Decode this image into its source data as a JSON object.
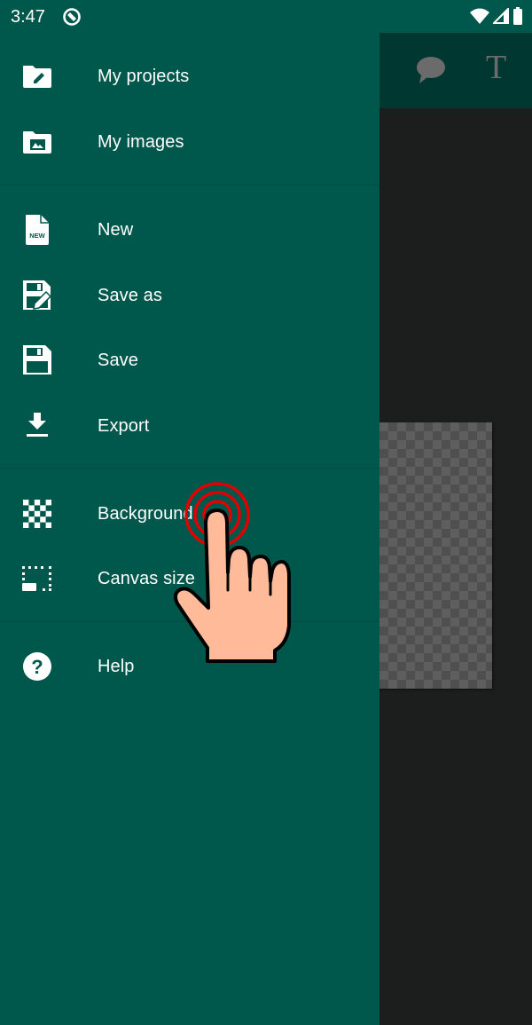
{
  "status_bar": {
    "time": "3:47",
    "icons": [
      "app-notification-icon",
      "wifi-icon",
      "cell-signal-icon",
      "battery-icon"
    ]
  },
  "app_toolbar": {
    "icons": [
      "comment-icon",
      "text-icon"
    ],
    "text_tool_glyph": "T"
  },
  "drawer": {
    "sections": [
      {
        "items": [
          {
            "label": "My projects",
            "icon": "folder-edit-icon"
          },
          {
            "label": "My images",
            "icon": "folder-image-icon"
          }
        ]
      },
      {
        "items": [
          {
            "label": "New",
            "icon": "new-file-icon",
            "icon_text": "NEW"
          },
          {
            "label": "Save as",
            "icon": "save-as-icon"
          },
          {
            "label": "Save",
            "icon": "save-icon"
          },
          {
            "label": "Export",
            "icon": "download-icon"
          }
        ]
      },
      {
        "items": [
          {
            "label": "Background",
            "icon": "checkerboard-icon"
          },
          {
            "label": "Canvas size",
            "icon": "canvas-size-icon"
          }
        ]
      },
      {
        "items": [
          {
            "label": "Help",
            "icon": "help-icon"
          }
        ]
      }
    ]
  },
  "touch_indicator": {
    "target": "Background",
    "ring_color": "#e00000",
    "hand_color": "#ffbb99"
  },
  "colors": {
    "drawer_bg": "#00574b",
    "toolbar_bg": "#003730",
    "canvas_bg": "#1c1d1d"
  }
}
